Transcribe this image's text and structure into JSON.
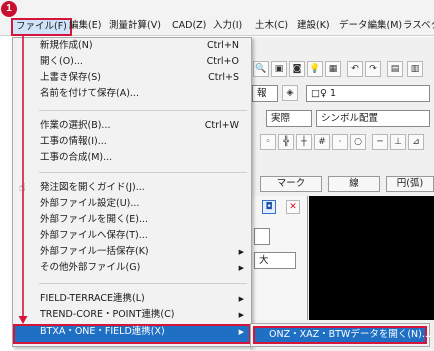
{
  "menubar": {
    "step_number": "1",
    "items": [
      {
        "label": "ファイル(F)"
      },
      {
        "label": "編集(E)"
      },
      {
        "label": "測量計算(V)"
      },
      {
        "label": "CAD(Z)"
      },
      {
        "label": "入力(I)"
      },
      {
        "label": "土木(C)"
      },
      {
        "label": "建設(K)"
      },
      {
        "label": "データ編集(M)"
      },
      {
        "label": "ラスベク"
      }
    ]
  },
  "background": {
    "field_1_value": "報",
    "field_2_value": "□♀ 1",
    "field_3_value": "実際",
    "field_4_value": "シンボル配置",
    "tabs": [
      "マーク",
      "線",
      "円(弧)"
    ],
    "panel_field_value": "大"
  },
  "file_menu": {
    "items": [
      {
        "label": "新規作成(N)",
        "shortcut": "Ctrl+N"
      },
      {
        "label": "開く(O)...",
        "shortcut": "Ctrl+O"
      },
      {
        "label": "上書き保存(S)",
        "shortcut": "Ctrl+S"
      },
      {
        "label": "名前を付けて保存(A)..."
      },
      {
        "label": "作業の選択(B)...",
        "shortcut": "Ctrl+W"
      },
      {
        "label": "工事の情報(I)..."
      },
      {
        "label": "工事の合成(M)..."
      },
      {
        "label": "発注図を開くガイド(J)..."
      },
      {
        "label": "外部ファイル設定(U)..."
      },
      {
        "label": "外部ファイルを開く(E)..."
      },
      {
        "label": "外部ファイルへ保存(T)..."
      },
      {
        "label": "外部ファイル一括保存(K)"
      },
      {
        "label": "その他外部ファイル(G)"
      },
      {
        "label": "FIELD-TERRACE連携(L)"
      },
      {
        "label": "TREND-CORE・POINT連携(C)"
      },
      {
        "label": "BTXA・ONE・FIELD連携(X)"
      }
    ]
  },
  "submenu": {
    "item_label": "ONZ・XAZ・BTWデータを開く(N)..."
  },
  "colors": {
    "highlight_blue": "#1f6fc5",
    "annotation_red": "#d6153b",
    "step_badge": "#c8102e"
  }
}
